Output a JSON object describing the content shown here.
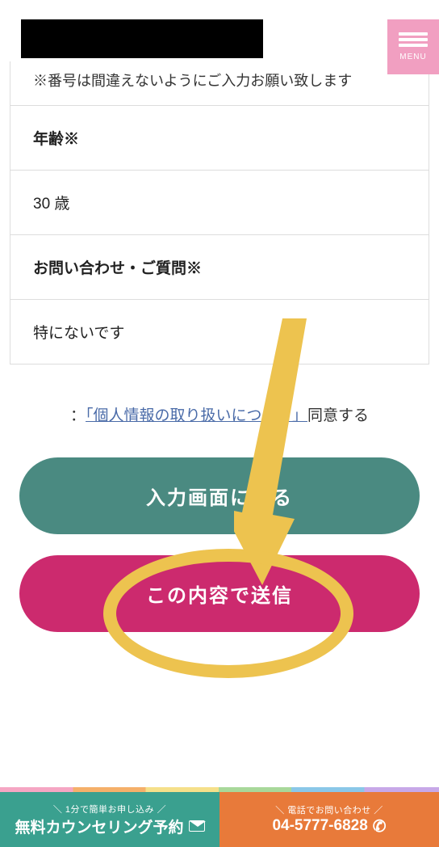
{
  "menu": {
    "label": "MENU"
  },
  "form": {
    "note": "※番号は間違えないようにご入力お願い致します",
    "age": {
      "label": "年齢※",
      "value_num": "30",
      "value_unit": "歳"
    },
    "inquiry": {
      "label": "お問い合わせ・ご質問※",
      "value": "特にないです"
    }
  },
  "consent": {
    "prefix": "：",
    "link_text": "「個人情報の取り扱いについて」",
    "suffix": "同意する"
  },
  "buttons": {
    "back": "入力画面に戻る",
    "submit": "この内容で送信"
  },
  "cta": {
    "left_top": "＼ 1分で簡単お申し込み ／",
    "left_bottom": "無料カウンセリング予約",
    "right_top": "＼ 電話でお問い合わせ ／",
    "right_bottom": "04-5777-6828"
  }
}
